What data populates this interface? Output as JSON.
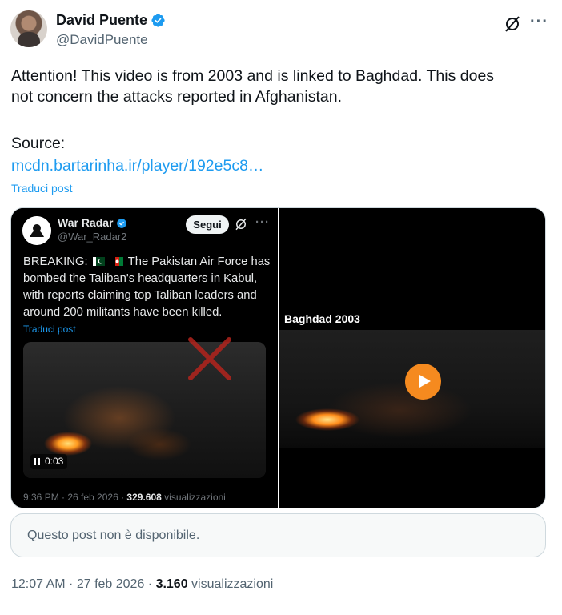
{
  "author": {
    "name": "David Puente",
    "handle": "@DavidPuente",
    "verified_color": "#1d9bf0",
    "icons": [
      "verified-badge-icon",
      "grok-icon",
      "more-options-icon"
    ]
  },
  "tweet": {
    "text_line1": "Attention! This video is from 2003 and is linked to Baghdad. This does",
    "text_line2": "not concern the attacks reported in Afghanistan.",
    "source_label": "Source:",
    "link": "mcdn.bartarinha.ir/player/192e5c8…",
    "translate": "Traduci post"
  },
  "embedded_left": {
    "name": "War Radar",
    "handle": "@War_Radar2",
    "follow_label": "Segui",
    "text_prefix": "BREAKING:",
    "text_body": "The Pakistan Air Force has bombed the Taliban's headquarters in Kabul, with reports claiming top Taliban leaders and around 200 militants have been killed.",
    "translate": "Traduci post",
    "video_time": "0:03",
    "meta_time": "9:36 PM · 26 feb 2026 · ",
    "meta_views": "329.608",
    "meta_views_label": " visualizzazioni"
  },
  "embedded_right": {
    "caption": "Baghdad 2003",
    "play_color": "#f58a1f"
  },
  "unavailable_text": "Questo post non è disponibile.",
  "footer": {
    "time": "12:07 AM · 27 feb 2026 · ",
    "views": "3.160",
    "views_label": " visualizzazioni"
  }
}
